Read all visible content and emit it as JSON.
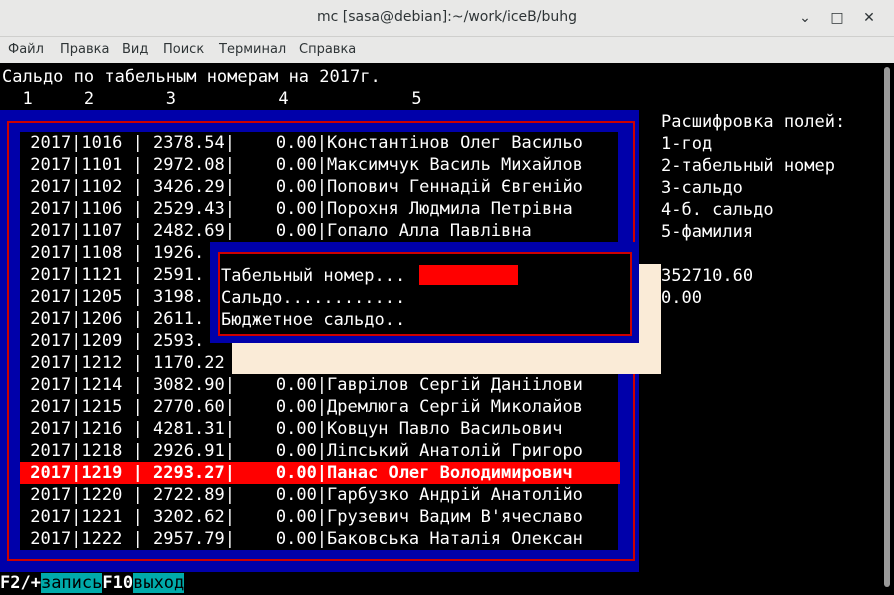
{
  "window": {
    "title": "mc [sasa@debian]:~/work/iceB/buhg",
    "minimize_glyph": "⌄",
    "maximize_glyph": "□",
    "close_glyph": "✕"
  },
  "menu": [
    "Файл",
    "Правка",
    "Вид",
    "Поиск",
    "Терминал",
    "Справка"
  ],
  "report": {
    "heading": "Сальдо по табельным номерам на 2017г.",
    "column_numbers": "  1     2       3          4            5",
    "rows": [
      " 2017|1016 | 2378.54|    0.00|Константінов Олег Васильо",
      " 2017|1101 | 2972.08|    0.00|Максимчук Василь Михайлов",
      " 2017|1102 | 3426.29|    0.00|Попович Геннадій Євгенійо",
      " 2017|1106 | 2529.43|    0.00|Порохня Людмила Петрівна",
      " 2017|1107 | 2482.69|    0.00|Гопало Алла Павлівна",
      " 2017|1108 | 1926.",
      " 2017|1121 | 2591.",
      " 2017|1205 | 3198.",
      " 2017|1206 | 2611.",
      " 2017|1209 | 2593.",
      " 2017|1212 | 1170.22",
      " 2017|1214 | 3082.90|    0.00|Гаврілов Сергій Даніілови",
      " 2017|1215 | 2770.60|    0.00|Дремлюга Сергій Миколайов",
      " 2017|1216 | 4281.31|    0.00|Ковцун Павло Васильович",
      " 2017|1218 | 2926.91|    0.00|Ліпський Анатолій Григоро",
      " 2017|1219 | 2293.27|    0.00|Панас Олег Володимирович",
      " 2017|1220 | 2722.89|    0.00|Гарбузко Андрій Анатолійо",
      " 2017|1221 | 3202.62|    0.00|Грузевич Вадим В'ячеславо",
      " 2017|1222 | 2957.79|    0.00|Баковська Наталія Олексан"
    ],
    "selected_row_index": 15
  },
  "legend": {
    "title": "Расшифровка полей:",
    "items": [
      "1-год",
      "2-табельный номер",
      "3-сальдо",
      "4-б. сальдо",
      "5-фамилия"
    ]
  },
  "totals": [
    "352710.60",
    "0.00"
  ],
  "dialog": {
    "tabnum_label": "Табельный номер...",
    "saldo_label": "Сальдо............",
    "budget_label": "Бюджетное сальдо.."
  },
  "bottom_bar": {
    "key1": "F2/+",
    "label1": "запись",
    "key2": "F10",
    "label2": "выход"
  },
  "colors": {
    "panel_blue": "#0000aa",
    "frame_red": "#cc0000",
    "highlight_red": "#ff0000",
    "hotkey_cyan": "#00aaaa",
    "shadow_beige": "#faebd7"
  }
}
